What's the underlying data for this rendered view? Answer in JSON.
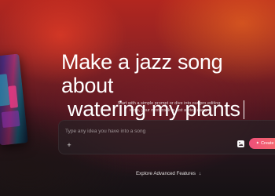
{
  "hero": {
    "headline_line1": "Make a jazz song about",
    "headline_line2": "watering my plants",
    "subtitle_line1": "Start with a simple prompt or dive into our pro editing",
    "subtitle_line2": "tools, your next track is just a step away."
  },
  "prompt": {
    "placeholder": "Type any idea you have into a song",
    "value": "",
    "add_icon": "plus-icon",
    "image_icon": "image-icon",
    "create_label": "Create",
    "create_icon": "sparkle-icon"
  },
  "footer": {
    "explore_label": "Explore Advanced Features",
    "explore_icon": "arrow-down-icon"
  },
  "colors": {
    "create_button": "#f0507a",
    "background_top": "#b2261f",
    "background_bottom": "#151214"
  }
}
